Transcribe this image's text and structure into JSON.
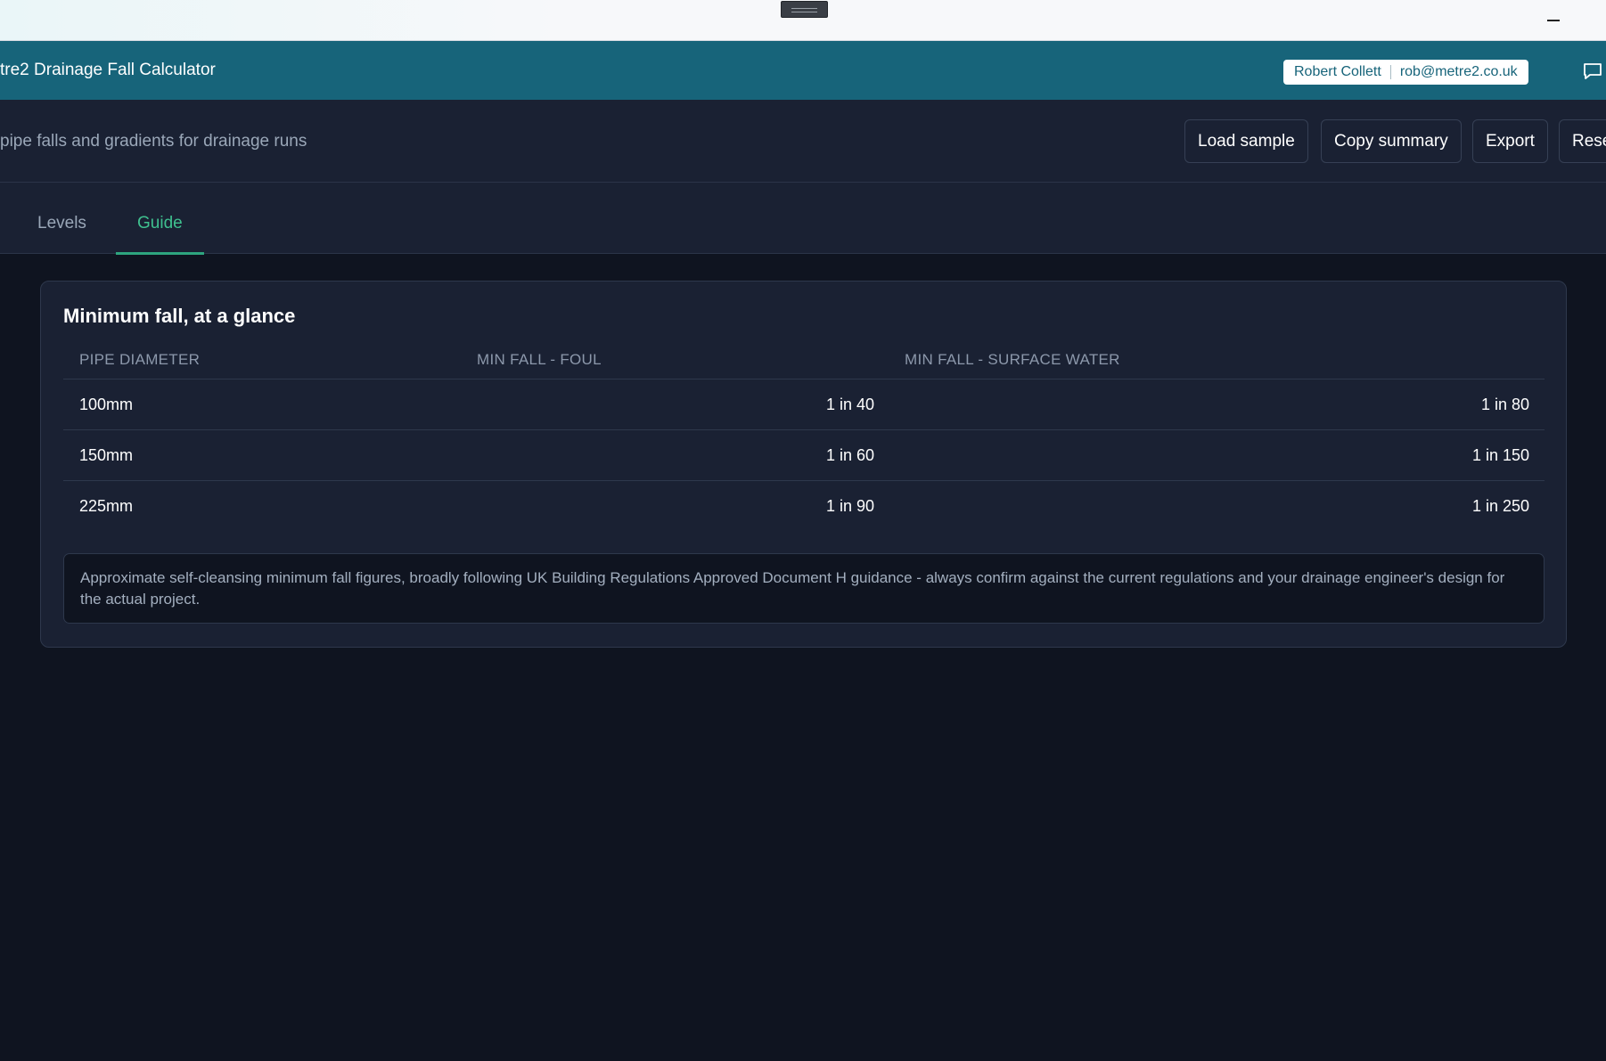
{
  "header": {
    "title": "tre2 Drainage Fall Calculator",
    "user_name": "Robert Collett",
    "user_email": "rob@metre2.co.uk"
  },
  "toolbar": {
    "subtitle": "pipe falls and gradients for drainage runs",
    "buttons": [
      "Load sample",
      "Copy summary",
      "Export",
      "Rese"
    ]
  },
  "tabs": [
    {
      "label": "Levels",
      "active": false
    },
    {
      "label": "Guide",
      "active": true
    }
  ],
  "guide": {
    "title": "Minimum fall, at a glance",
    "columns": [
      "PIPE DIAMETER",
      "MIN FALL - FOUL",
      "MIN FALL - SURFACE WATER"
    ],
    "rows": [
      [
        "100mm",
        "1 in 40",
        "1 in 80"
      ],
      [
        "150mm",
        "1 in 60",
        "1 in 150"
      ],
      [
        "225mm",
        "1 in 90",
        "1 in 250"
      ]
    ],
    "note": "Approximate self-cleansing minimum fall figures, broadly following UK Building Regulations Approved Document H guidance - always confirm against the current regulations and your drainage engineer's design for the actual project."
  },
  "colors": {
    "header_bg": "#17647a",
    "accent": "#3fc08f",
    "page_bg": "#0f1420",
    "panel_bg": "#1a2133"
  },
  "icons": [
    "drag-handle-icon",
    "minimize-icon",
    "chat-icon"
  ]
}
